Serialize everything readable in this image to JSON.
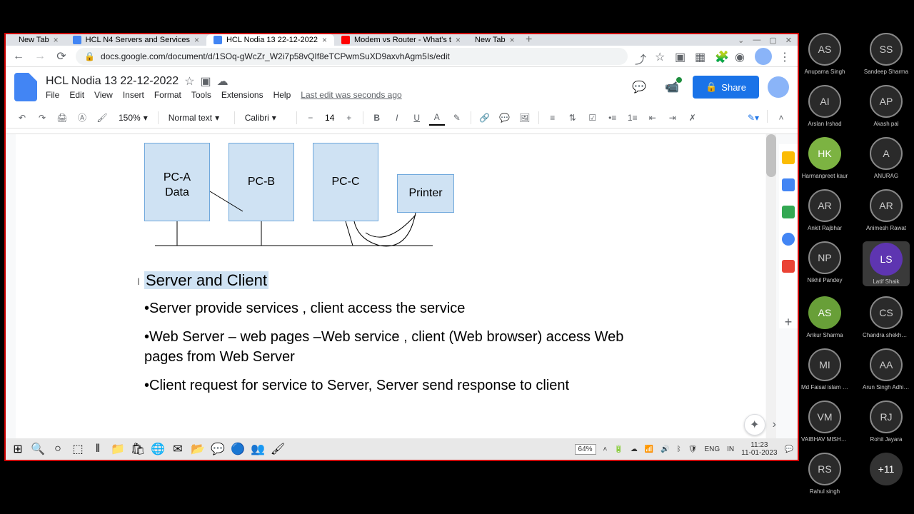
{
  "browser": {
    "tabs": [
      {
        "title": "New Tab",
        "active": false
      },
      {
        "title": "HCL N4 Servers and Services",
        "active": false
      },
      {
        "title": "HCL Nodia 13 22-12-2022",
        "active": true
      },
      {
        "title": "Modem vs Router - What's t",
        "active": false
      },
      {
        "title": "New Tab",
        "active": false
      }
    ],
    "url": "docs.google.com/document/d/1SOq-gWcZr_W2i7p58vQIf8eTCPwmSuXD9axvhAgm5Is/edit"
  },
  "docs": {
    "title": "HCL Nodia 13 22-12-2022",
    "menu": [
      "File",
      "Edit",
      "View",
      "Insert",
      "Format",
      "Tools",
      "Extensions",
      "Help"
    ],
    "last_edit": "Last edit was seconds ago",
    "share": "Share",
    "zoom": "150%",
    "style": "Normal text",
    "font": "Calibri",
    "size": "14"
  },
  "diagram": {
    "pca": "PC-A\nData",
    "pcb": "PC-B",
    "pcc": "PC-C",
    "printer": "Printer"
  },
  "content": {
    "heading": "Server and Client",
    "b1": "•Server provide services , client access the service",
    "b2": "•Web Server – web pages –Web  service , client (Web browser) access Web pages from Web Server",
    "b3": "•Client request for service to Server, Server send response to client"
  },
  "taskbar": {
    "battery": "64%",
    "lang1": "ENG",
    "lang2": "IN",
    "time": "11:23",
    "date": "11-01-2023"
  },
  "participants": [
    [
      {
        "initials": "AS",
        "name": "Anupama Singh",
        "ring": true
      },
      {
        "initials": "SS",
        "name": "Sandeep Sharma",
        "ring": true
      }
    ],
    [
      {
        "initials": "AI",
        "name": "Arslan Irshad",
        "ring": true
      },
      {
        "initials": "AP",
        "name": "Akash pal",
        "ring": true
      }
    ],
    [
      {
        "initials": "HK",
        "name": "Harmanpreet kaur",
        "bg": "#7cb342"
      },
      {
        "initials": "A",
        "name": "ANURAG",
        "ring": true
      }
    ],
    [
      {
        "initials": "AR",
        "name": "Ankit Rajbhar",
        "ring": true
      },
      {
        "initials": "AR",
        "name": "Animesh Rawat",
        "ring": true
      }
    ],
    [
      {
        "initials": "NP",
        "name": "Nikhil Pandey",
        "ring": true
      },
      {
        "initials": "LS",
        "name": "Latif Shaik",
        "bg": "#5e35b1",
        "active": true
      }
    ],
    [
      {
        "initials": "AS",
        "name": "Ankur Sharma",
        "bg": "#689f38"
      },
      {
        "initials": "CS",
        "name": "Chandra shekhar...",
        "ring": true
      }
    ],
    [
      {
        "initials": "MI",
        "name": "Md Faisal islam (...",
        "ring": true
      },
      {
        "initials": "AA",
        "name": "Arun Singh Adhik...",
        "ring": true
      }
    ],
    [
      {
        "initials": "VM",
        "name": "VAIBHAV MISHRA",
        "ring": true
      },
      {
        "initials": "RJ",
        "name": "Rohit Jayara",
        "ring": true
      }
    ],
    [
      {
        "initials": "RS",
        "name": "Rahul singh",
        "ring": true
      },
      {
        "initials": "+11",
        "name": "",
        "bg": "#333"
      }
    ]
  ]
}
